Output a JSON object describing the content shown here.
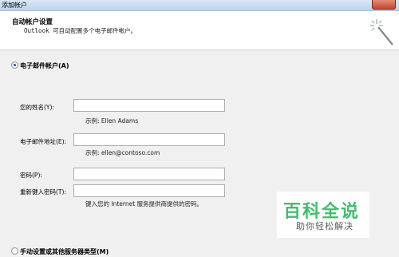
{
  "window": {
    "title": "添加帐户"
  },
  "header": {
    "title": "自动帐户设置",
    "subtitle": "Outlook 可自动配置多个电子邮件帐户。",
    "icon": "magic-wand-icon"
  },
  "options": {
    "email_account": {
      "label": "电子邮件帐户(A)",
      "selected": true
    },
    "manual_setup": {
      "label": "手动设置或其他服务器类型(M)",
      "selected": false
    }
  },
  "fields": {
    "name": {
      "label": "您的姓名(Y):",
      "value": "",
      "hint": "示例: Ellen Adams"
    },
    "email": {
      "label": "电子邮件地址(E):",
      "value": "",
      "hint": "示例: ellen@contoso.com"
    },
    "password": {
      "label": "密码(P):",
      "value": ""
    },
    "retype_password": {
      "label": "重新键入密码(T):",
      "value": "",
      "hint": "键入您的 Internet 服务提供商提供的密码。"
    }
  },
  "watermark": {
    "main": "百科全说",
    "sub": "助你轻松解决"
  },
  "colors": {
    "watermark_green": "#3cba6b",
    "titlebar": "#bcd2ea"
  }
}
